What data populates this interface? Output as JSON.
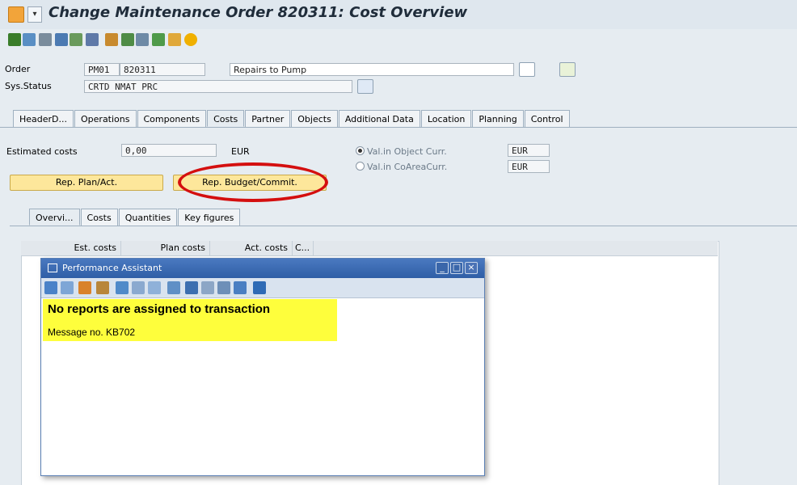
{
  "window": {
    "title": "Change Maintenance Order 820311: Cost Overview",
    "menu_arrow": "▾"
  },
  "toolbar": {
    "icons": [
      "flag-icon",
      "hierarchy-icon",
      "list-icon",
      "calculator-icon",
      "structure-icon",
      "filter-icon",
      "objects-icon",
      "document-icon",
      "edit-icon",
      "print-icon",
      "info-circle-icon"
    ]
  },
  "header": {
    "order_label": "Order",
    "order_type": "PM01",
    "order_number": "820311",
    "order_description": "Repairs to Pump",
    "sys_status_label": "Sys.Status",
    "sys_status_value": "CRTD NMAT PRC"
  },
  "tabs": [
    {
      "label": "HeaderD...",
      "active": false
    },
    {
      "label": "Operations",
      "active": false
    },
    {
      "label": "Components",
      "active": false
    },
    {
      "label": "Costs",
      "active": true
    },
    {
      "label": "Partner",
      "active": false
    },
    {
      "label": "Objects",
      "active": false
    },
    {
      "label": "Additional Data",
      "active": false
    },
    {
      "label": "Location",
      "active": false
    },
    {
      "label": "Planning",
      "active": false
    },
    {
      "label": "Control",
      "active": false
    }
  ],
  "costs": {
    "estimated_label": "Estimated costs",
    "estimated_value": "0,00",
    "currency": "EUR",
    "radio_object_curr": "Val.in Object Curr.",
    "radio_object_curr_value": "EUR",
    "radio_coarea_curr": "Val.in CoAreaCurr.",
    "radio_coarea_curr_value": "EUR",
    "btn_plan_act": "Rep. Plan/Act.",
    "btn_budget_commit": "Rep. Budget/Commit."
  },
  "subtabs": [
    {
      "label": "Overvi...",
      "active": true
    },
    {
      "label": "Costs",
      "active": false
    },
    {
      "label": "Quantities",
      "active": false
    },
    {
      "label": "Key figures",
      "active": false
    }
  ],
  "table": {
    "columns": [
      "Est. costs",
      "Plan costs",
      "Act. costs",
      "C..."
    ]
  },
  "dialog": {
    "title": "Performance Assistant",
    "message_title": "No reports are assigned to transaction",
    "message_number": "Message no. KB702",
    "toolbar_icons": [
      "back-icon",
      "forward-icon",
      "home-icon",
      "structure-icon",
      "edit-icon",
      "link-icon",
      "glasses-icon",
      "book-icon",
      "bookmark-icon",
      "export-icon",
      "print-icon",
      "find-icon",
      "close-icon"
    ]
  },
  "colors": {
    "highlight": "#d40f0f",
    "message_bg": "#fefe3c",
    "dialog_title": "#2f5ea6"
  }
}
